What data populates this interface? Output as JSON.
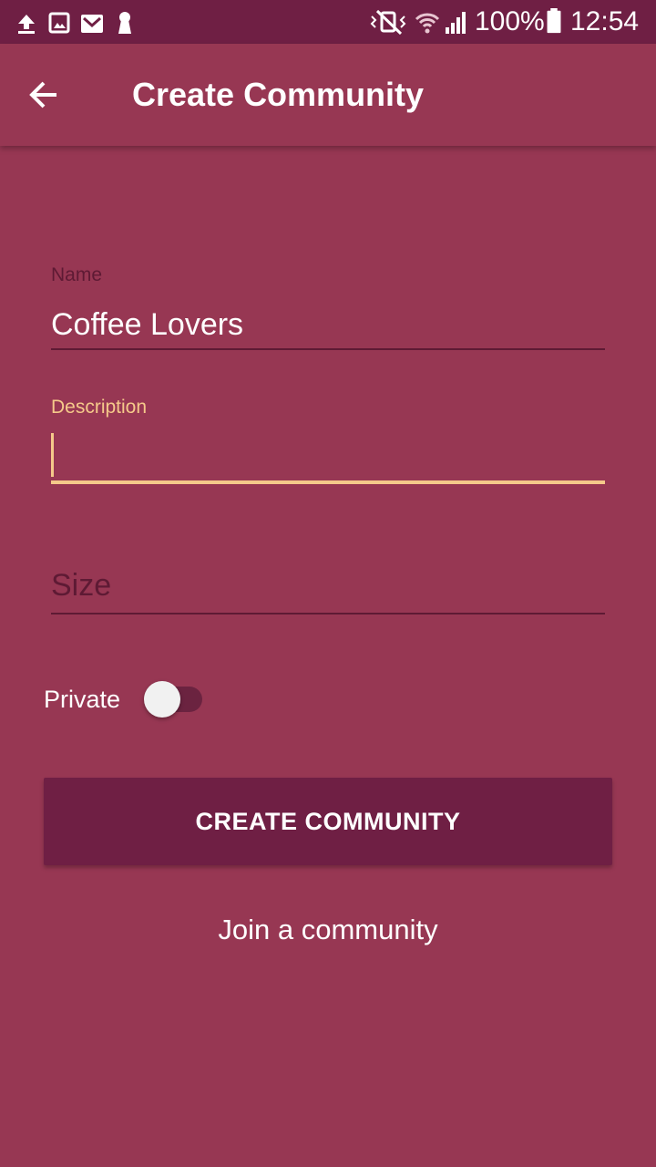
{
  "status_bar": {
    "battery_text": "100%",
    "time": "12:54",
    "icons": [
      "upload-icon",
      "image-icon",
      "gmail-icon",
      "keyhole-icon",
      "vibrate-mute-icon",
      "wifi-icon",
      "signal-icon",
      "battery-icon"
    ]
  },
  "app_bar": {
    "title": "Create Community",
    "back_icon": "arrow-back-icon"
  },
  "form": {
    "name": {
      "label": "Name",
      "value": "Coffee Lovers"
    },
    "description": {
      "label": "Description",
      "value": ""
    },
    "size": {
      "placeholder": "Size",
      "value": ""
    },
    "private": {
      "label": "Private",
      "checked": false
    }
  },
  "actions": {
    "create_label": "CREATE COMMUNITY",
    "join_label": "Join a community"
  },
  "colors": {
    "background": "#973753",
    "status_bar": "#6f1f44",
    "button": "#6f1f44",
    "accent": "#f5c98a",
    "muted": "#5e1a34"
  }
}
